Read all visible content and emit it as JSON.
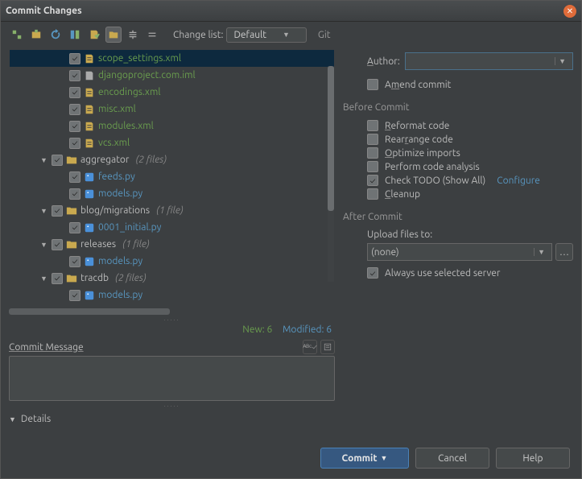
{
  "title": "Commit Changes",
  "toolbar": {
    "change_list_label": "Change list:",
    "change_list_value": "Default",
    "vcs_label": "Git"
  },
  "tree": {
    "nodes": [
      {
        "indent": 2,
        "checked": true,
        "icon": "xml",
        "name": "scope_settings.xml",
        "color": "green",
        "selected": true
      },
      {
        "indent": 2,
        "checked": true,
        "icon": "file",
        "name": "djangoproject.com.iml",
        "color": "green"
      },
      {
        "indent": 2,
        "checked": true,
        "icon": "xml",
        "name": "encodings.xml",
        "color": "green"
      },
      {
        "indent": 2,
        "checked": true,
        "icon": "xml",
        "name": "misc.xml",
        "color": "green"
      },
      {
        "indent": 2,
        "checked": true,
        "icon": "xml",
        "name": "modules.xml",
        "color": "green"
      },
      {
        "indent": 2,
        "checked": true,
        "icon": "xml",
        "name": "vcs.xml",
        "color": "green"
      },
      {
        "indent": 0,
        "expander": "▼",
        "checked": true,
        "icon": "folder",
        "name": "aggregator",
        "count": "(2 files)"
      },
      {
        "indent": 2,
        "checked": true,
        "icon": "py",
        "name": "feeds.py",
        "color": "blue"
      },
      {
        "indent": 2,
        "checked": true,
        "icon": "py",
        "name": "models.py",
        "color": "blue"
      },
      {
        "indent": 0,
        "expander": "▼",
        "checked": true,
        "icon": "folder",
        "name": "blog/migrations",
        "count": "(1 file)"
      },
      {
        "indent": 2,
        "checked": true,
        "icon": "py",
        "name": "0001_initial.py",
        "color": "blue"
      },
      {
        "indent": 0,
        "expander": "▼",
        "checked": true,
        "icon": "folder",
        "name": "releases",
        "count": "(1 file)"
      },
      {
        "indent": 2,
        "checked": true,
        "icon": "py",
        "name": "models.py",
        "color": "blue"
      },
      {
        "indent": 0,
        "expander": "▼",
        "checked": true,
        "icon": "folder",
        "name": "tracdb",
        "count": "(2 files)"
      },
      {
        "indent": 2,
        "checked": true,
        "icon": "py",
        "name": "models.py",
        "color": "blue"
      }
    ]
  },
  "status": {
    "new_label": "New: 6",
    "modified_label": "Modified: 6"
  },
  "commit_message_label": "Commit Message",
  "details_label": "Details",
  "git": {
    "author_label": "Author:",
    "author_value": "",
    "amend_label": "Amend commit",
    "amend_checked": false
  },
  "before": {
    "header": "Before Commit",
    "items": [
      {
        "label": "Reformat code",
        "checked": false,
        "u": 0
      },
      {
        "label": "Rearrange code",
        "checked": false,
        "u": 4
      },
      {
        "label": "Optimize imports",
        "checked": false,
        "u": 0
      },
      {
        "label": "Perform code analysis",
        "checked": false
      },
      {
        "label": "Check TODO (Show All)",
        "checked": true,
        "link": "Configure"
      },
      {
        "label": "Cleanup",
        "checked": false,
        "u": 0
      }
    ]
  },
  "after": {
    "header": "After Commit",
    "upload_label": "Upload files to:",
    "upload_value": "(none)",
    "always_label": "Always use selected server",
    "always_checked": true
  },
  "buttons": {
    "commit": "Commit",
    "cancel": "Cancel",
    "help": "Help"
  }
}
